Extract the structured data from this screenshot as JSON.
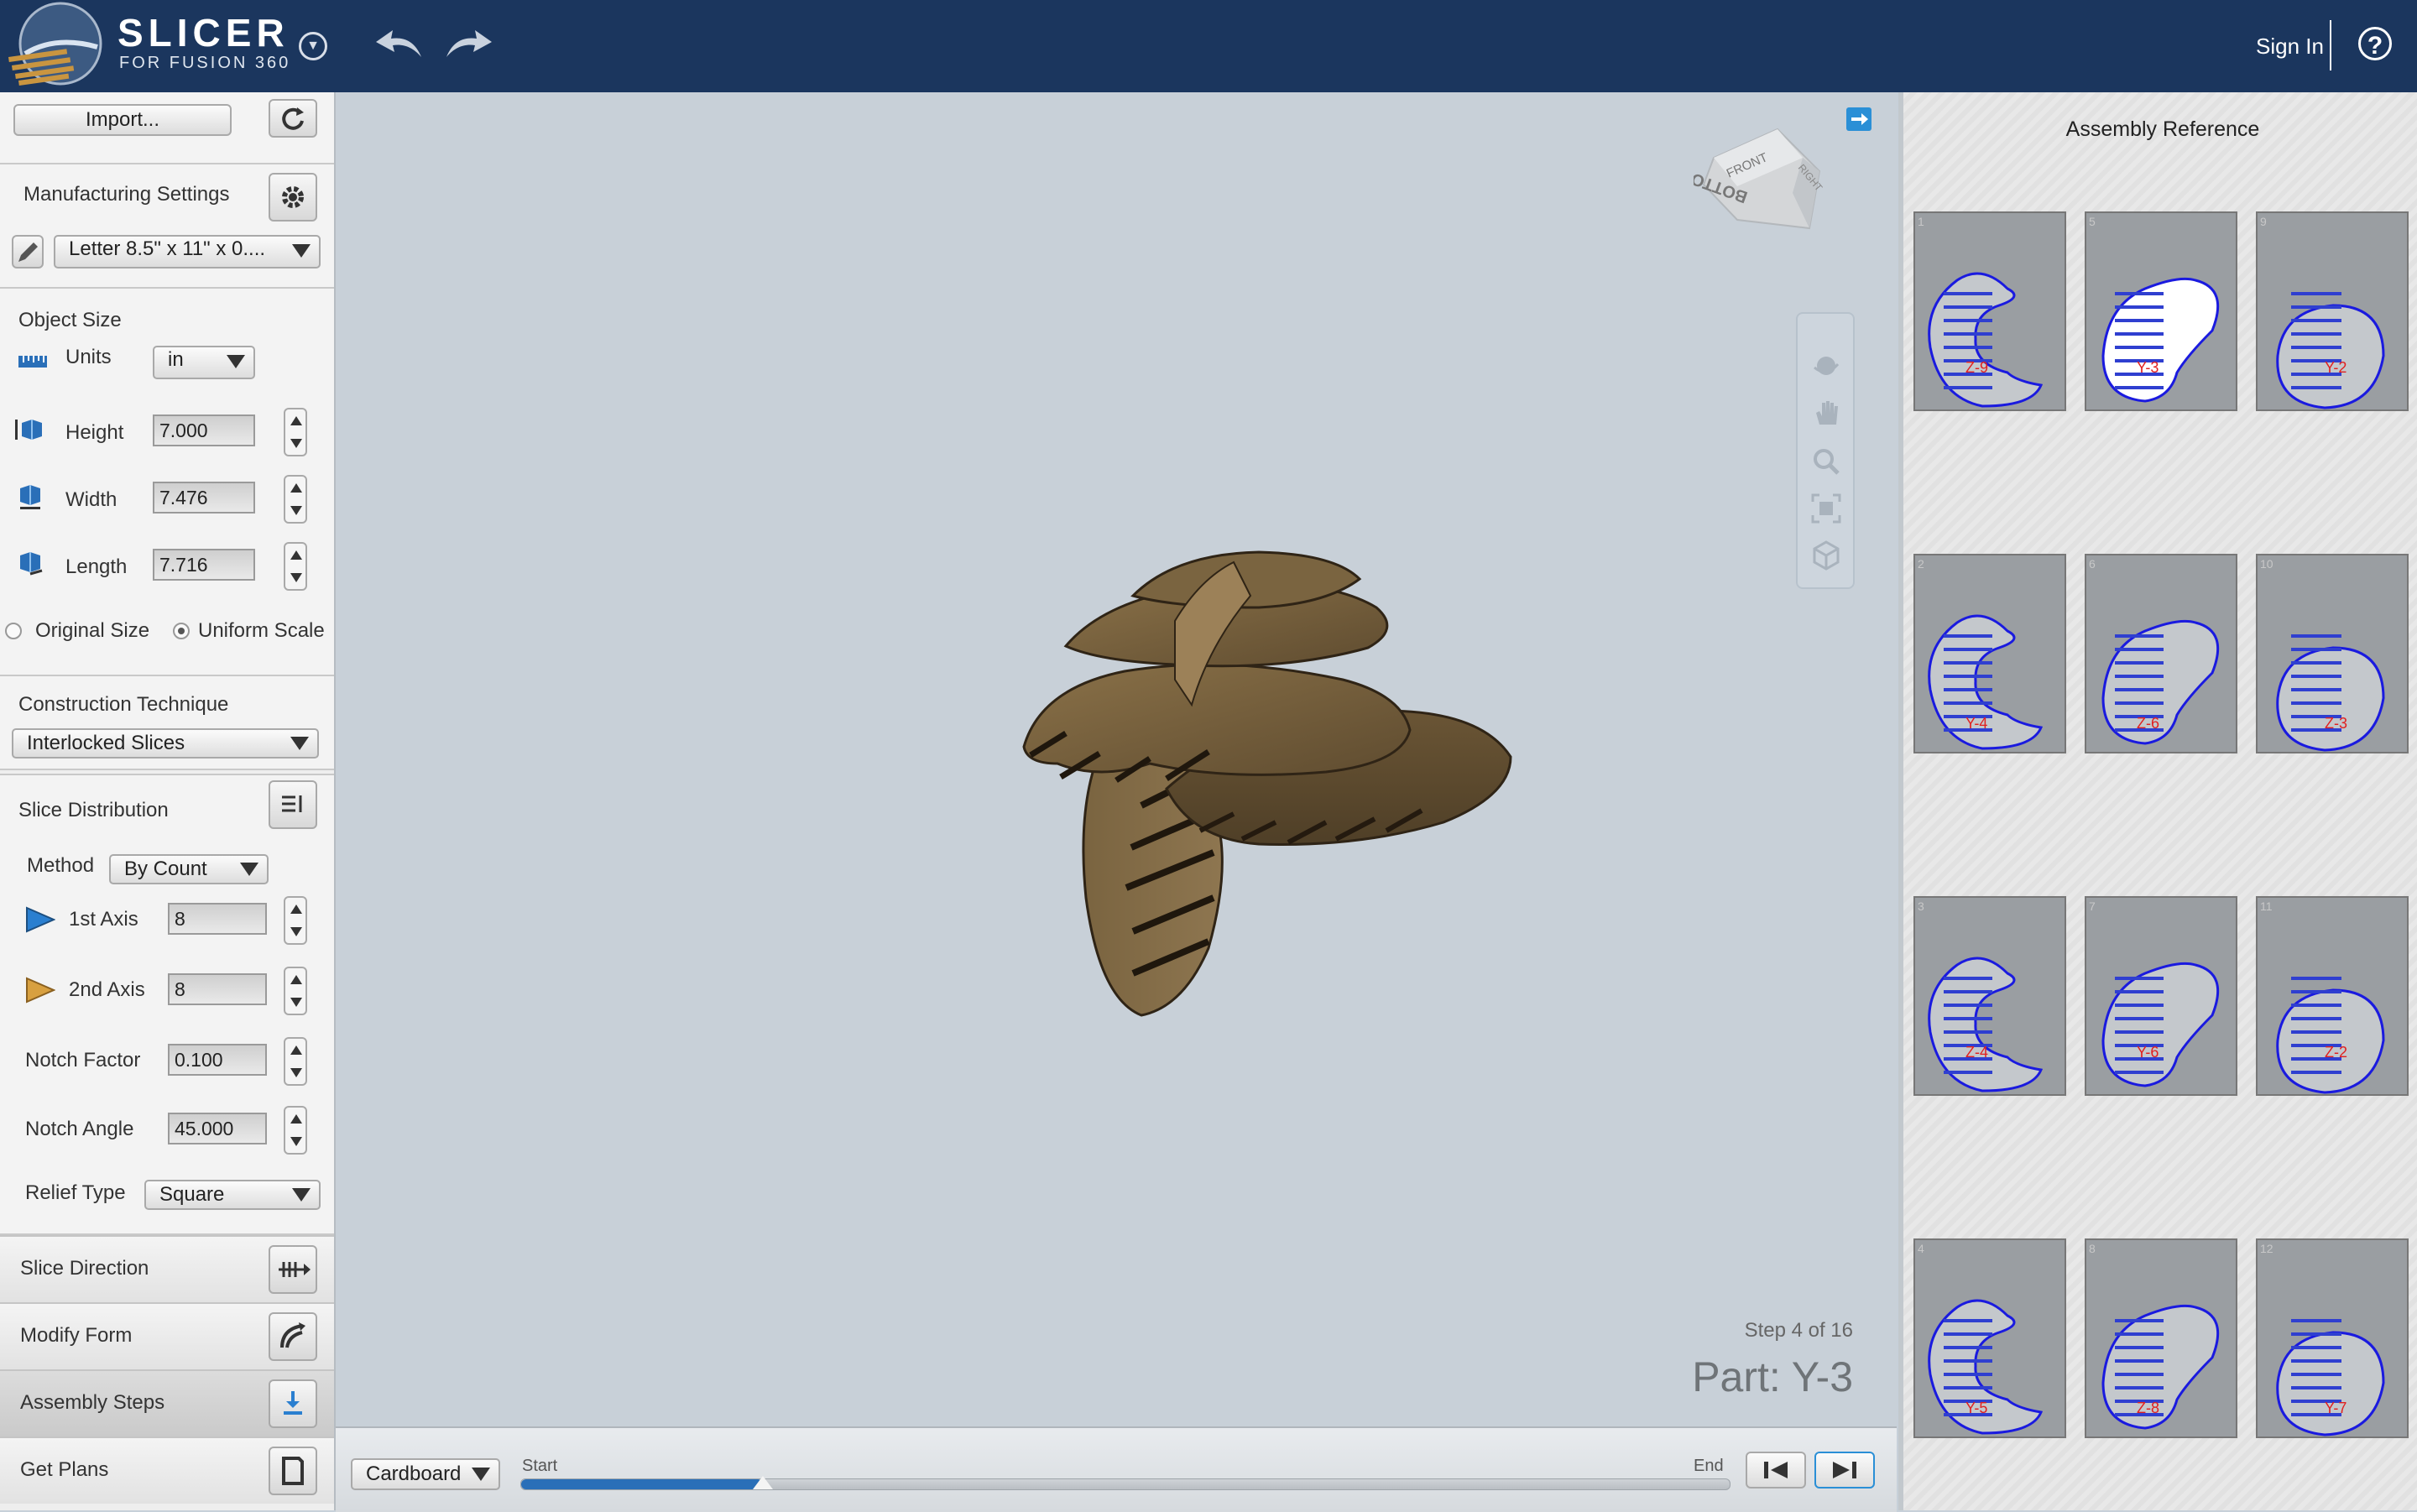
{
  "app": {
    "title": "SLICER",
    "subtitle": "FOR FUSION 360"
  },
  "header": {
    "sign_in": "Sign In",
    "help": "?"
  },
  "left": {
    "import_label": "Import...",
    "manufacturing": {
      "label": "Manufacturing Settings",
      "sheet_value": "Letter 8.5\" x 11\" x 0...."
    },
    "object_size": {
      "label": "Object Size",
      "units_label": "Units",
      "units_value": "in",
      "height_label": "Height",
      "height_value": "7.000",
      "width_label": "Width",
      "width_value": "7.476",
      "length_label": "Length",
      "length_value": "7.716",
      "original_size": "Original Size",
      "uniform_scale": "Uniform Scale"
    },
    "construction": {
      "label": "Construction Technique",
      "value": "Interlocked Slices"
    },
    "slice_distribution": {
      "label": "Slice Distribution",
      "method_label": "Method",
      "method_value": "By Count",
      "axis1_label": "1st Axis",
      "axis1_value": "8",
      "axis2_label": "2nd Axis",
      "axis2_value": "8",
      "notch_factor_label": "Notch Factor",
      "notch_factor_value": "0.100",
      "notch_angle_label": "Notch Angle",
      "notch_angle_value": "45.000",
      "relief_label": "Relief Type",
      "relief_value": "Square"
    },
    "steps": [
      {
        "label": "Slice Direction"
      },
      {
        "label": "Modify Form"
      },
      {
        "label": "Assembly Steps"
      },
      {
        "label": "Get Plans"
      }
    ]
  },
  "viewport": {
    "viewcube": {
      "front": "FRONT",
      "right": "RIGHT",
      "bottom": "BOTTOM"
    },
    "step_text": "Step 4 of 16",
    "part_text": "Part: Y-3"
  },
  "bottom": {
    "material": "Cardboard",
    "start_label": "Start",
    "end_label": "End",
    "progress": 0.2
  },
  "assembly": {
    "title": "Assembly Reference",
    "thumbs": [
      {
        "num": "1",
        "label": "Z-9"
      },
      {
        "num": "5",
        "label": "Y-3"
      },
      {
        "num": "9",
        "label": "Y-2"
      },
      {
        "num": "2",
        "label": "Y-4"
      },
      {
        "num": "6",
        "label": "Z-6"
      },
      {
        "num": "10",
        "label": "Z-3"
      },
      {
        "num": "3",
        "label": "Z-4"
      },
      {
        "num": "7",
        "label": "Y-6"
      },
      {
        "num": "11",
        "label": "Z-2"
      },
      {
        "num": "4",
        "label": "Y-5"
      },
      {
        "num": "8",
        "label": "Z-8"
      },
      {
        "num": "12",
        "label": "Y-7"
      }
    ]
  },
  "colors": {
    "header_bg": "#1b365e",
    "viewport_bg": "#c8d0d8",
    "cardboard": "#7d6640",
    "accent_blue": "#2a8fd6",
    "outline_blue": "#1a1adf",
    "label_red": "#e02020"
  }
}
